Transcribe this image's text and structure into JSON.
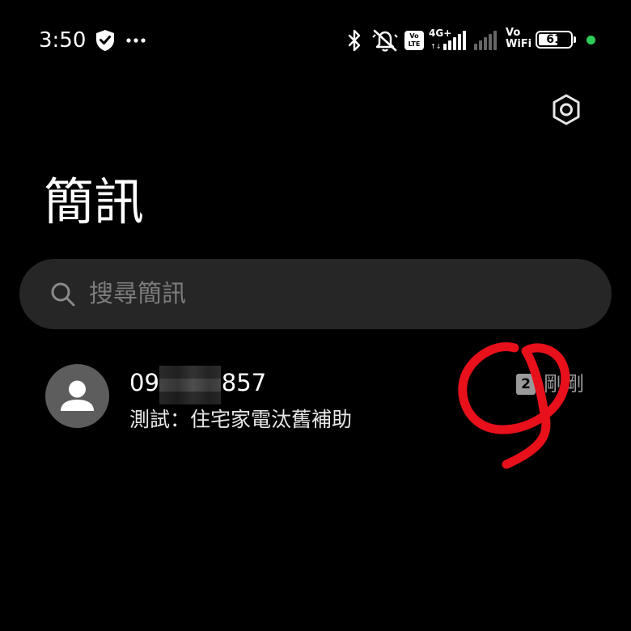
{
  "status_bar": {
    "time": "3:50",
    "network_label": "4G+",
    "vowifi_line1": "Vo",
    "vowifi_line2": "WiFi",
    "volte_line1": "Vo",
    "volte_line2": "LTE",
    "battery_level": "61",
    "battery_fraction": 0.61,
    "charge_dot_color": "#2ecc58",
    "icons": [
      "shield-check-icon",
      "more-dots-icon",
      "bluetooth-icon",
      "mute-icon",
      "volte-icon",
      "signal-icon",
      "signal-weak-icon",
      "vowifi-icon",
      "battery-icon"
    ]
  },
  "header": {
    "title": "簡訊",
    "settings_icon": "settings-hexagon-icon"
  },
  "search": {
    "placeholder": "搜尋簡訊"
  },
  "conversations": [
    {
      "number_prefix": "090",
      "number_suffix": "0857",
      "snippet": "測試：住宅家電汰舊補助",
      "sim_slot": "2",
      "time": "剛剛"
    }
  ],
  "colors": {
    "background": "#000000",
    "search_bg": "#262626",
    "avatar_bg": "#5d5d5d",
    "annotation": "#e8101a"
  }
}
